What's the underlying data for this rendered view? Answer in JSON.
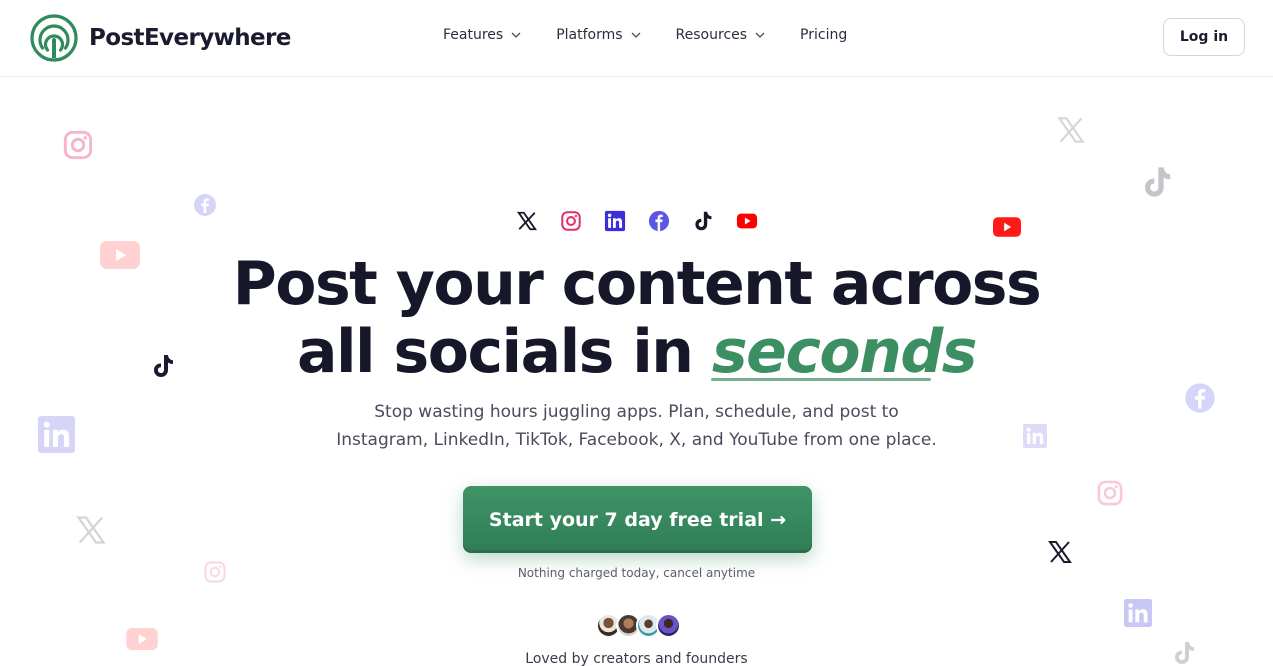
{
  "brand": {
    "name": "PostEverywhere",
    "color": "#3c8f63"
  },
  "nav": {
    "items": [
      {
        "label": "Features",
        "icon": "chevron-down-icon"
      },
      {
        "label": "Platforms",
        "icon": "chevron-down-icon"
      },
      {
        "label": "Resources",
        "icon": "chevron-down-icon"
      },
      {
        "label": "Pricing"
      }
    ],
    "login_label": "Log in"
  },
  "hero": {
    "platform_icons": [
      "x-icon",
      "instagram-icon",
      "linkedin-icon",
      "facebook-icon",
      "tiktok-icon",
      "youtube-icon"
    ],
    "headline_line1": "Post your content across",
    "headline_line2_prefix": "all socials in",
    "headline_accent": "seconds",
    "subtitle_line1": "Stop wasting hours juggling apps. Plan, schedule, and post to",
    "subtitle_line2": "Instagram, LinkedIn, TikTok, Facebook, X, and YouTube from one place.",
    "cta_label": "Start your 7 day free trial →",
    "cta_note": "Nothing charged today, cancel anytime",
    "social_proof": "Loved by creators and founders"
  },
  "colors": {
    "accent": "#3c8f63",
    "text": "#161728",
    "instagram": "#e1306c",
    "linkedin": "#3b2fd8",
    "facebook": "#5b56e8",
    "youtube": "#ff0000"
  }
}
